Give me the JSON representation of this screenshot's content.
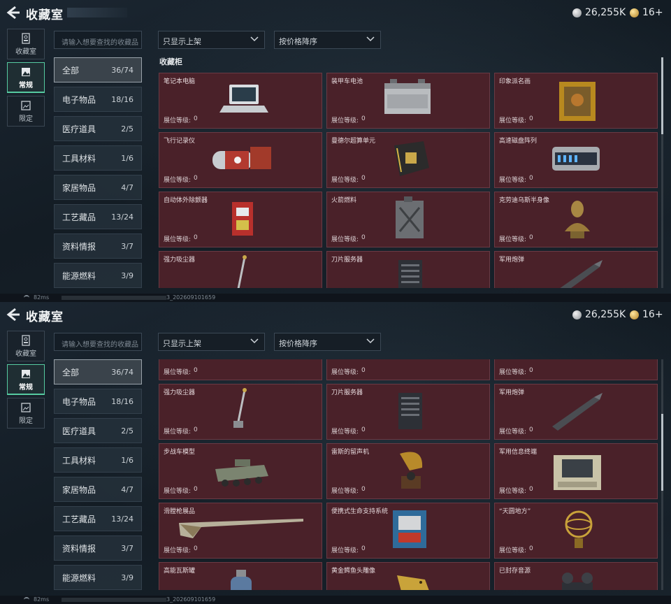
{
  "header": {
    "title": "收藏室",
    "silver_amount": "26,255K",
    "gold_amount": "16+"
  },
  "nav": [
    {
      "label": "收藏室",
      "icon": "vault-icon"
    },
    {
      "label": "常规",
      "icon": "image-icon",
      "active": true
    },
    {
      "label": "限定",
      "icon": "image-limited-icon"
    }
  ],
  "search": {
    "placeholder": "请输入想要查找的收藏品"
  },
  "filters": {
    "display": "只显示上架",
    "sort": "按价格降序"
  },
  "section_title": "收藏柜",
  "categories": [
    {
      "name": "全部",
      "count": "36/74",
      "active": true
    },
    {
      "name": "电子物品",
      "count": "18/16"
    },
    {
      "name": "医疗道具",
      "count": "2/5"
    },
    {
      "name": "工具材料",
      "count": "1/6"
    },
    {
      "name": "家居物品",
      "count": "4/7"
    },
    {
      "name": "工艺藏品",
      "count": "13/24"
    },
    {
      "name": "资料情报",
      "count": "3/7"
    },
    {
      "name": "能源燃料",
      "count": "3/9"
    }
  ],
  "level_label": "展位等级:",
  "level_value": "0",
  "items_panel1": [
    {
      "name": "笔记本电脑",
      "art": "laptop-icon"
    },
    {
      "name": "装甲车电池",
      "art": "battery-icon"
    },
    {
      "name": "印象派名画",
      "art": "painting-icon"
    },
    {
      "name": "飞行记录仪",
      "art": "flight-recorder-icon"
    },
    {
      "name": "曼德尔超算单元",
      "art": "circuit-board-icon"
    },
    {
      "name": "高速磁盘阵列",
      "art": "disk-array-icon"
    },
    {
      "name": "自动体外除颤器",
      "art": "defibrillator-icon"
    },
    {
      "name": "火箭燃料",
      "art": "fuel-canister-icon"
    },
    {
      "name": "克劳迪乌斯半身像",
      "art": "bust-icon"
    },
    {
      "name": "强力吸尘器",
      "art": "vacuum-icon"
    },
    {
      "name": "刀片服务器",
      "art": "server-icon"
    },
    {
      "name": "军用炮弹",
      "art": "shell-icon"
    }
  ],
  "items_panel2": [
    {
      "name": "",
      "art": ""
    },
    {
      "name": "",
      "art": ""
    },
    {
      "name": "",
      "art": ""
    },
    {
      "name": "强力吸尘器",
      "art": "vacuum-icon"
    },
    {
      "name": "刀片服务器",
      "art": "server-icon"
    },
    {
      "name": "军用炮弹",
      "art": "shell-icon"
    },
    {
      "name": "步战车模型",
      "art": "ifv-model-icon"
    },
    {
      "name": "雷斯的留声机",
      "art": "gramophone-icon"
    },
    {
      "name": "军用信息终端",
      "art": "terminal-case-icon"
    },
    {
      "name": "滑膛枪展品",
      "art": "musket-icon"
    },
    {
      "name": "便携式生命支持系统",
      "art": "life-support-icon"
    },
    {
      "name": "“天圆地方”",
      "art": "armillary-icon"
    },
    {
      "name": "高能瓦斯罐",
      "art": "gas-tank-icon"
    },
    {
      "name": "黄金鳄鱼头雕像",
      "art": "croc-statue-icon"
    },
    {
      "name": "已封存音源",
      "art": "reel-recorder-icon"
    }
  ],
  "status": {
    "ping": "82ms",
    "build": "3_202609101659"
  },
  "colors": {
    "card_bg": "#4a2129",
    "accent": "#56cba1"
  }
}
